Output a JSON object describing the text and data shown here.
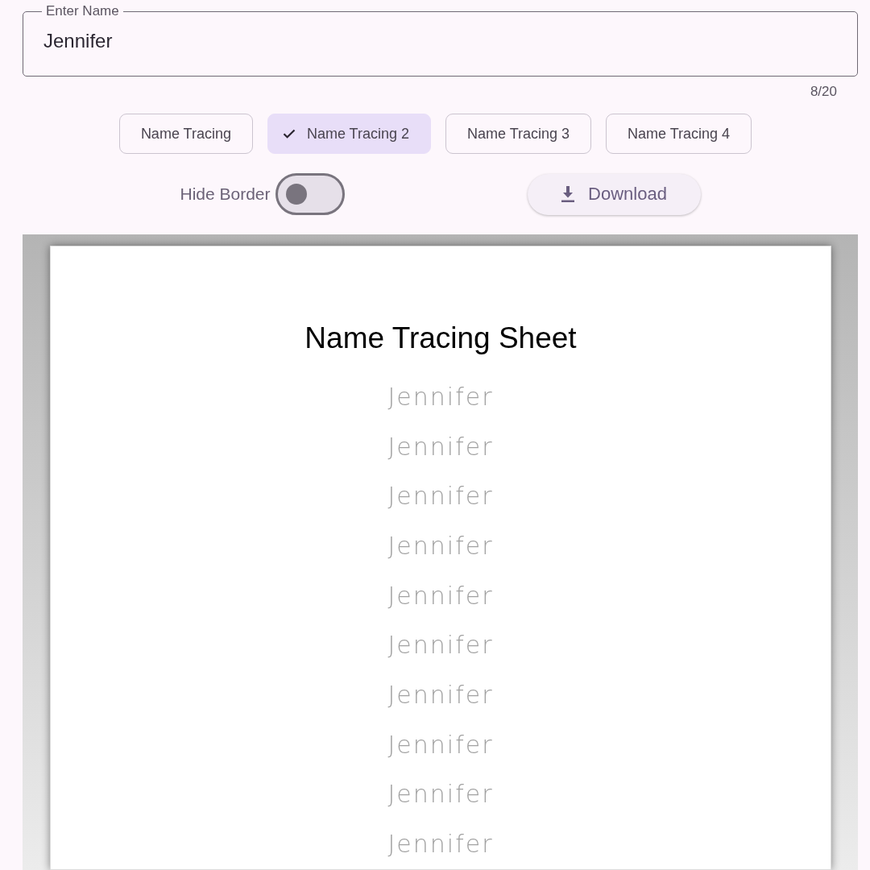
{
  "name_field": {
    "label": "Enter Name",
    "value": "Jennifer",
    "counter": "8/20"
  },
  "styles": [
    {
      "label": "Name Tracing",
      "selected": false
    },
    {
      "label": "Name Tracing 2",
      "selected": true
    },
    {
      "label": "Name Tracing 3",
      "selected": false
    },
    {
      "label": "Name Tracing 4",
      "selected": false
    }
  ],
  "hide_border": {
    "label": "Hide Border",
    "on": false
  },
  "download_button": {
    "label": "Download"
  },
  "sheet": {
    "title": "Name Tracing Sheet",
    "lines": [
      "Jennifer",
      "Jennifer",
      "Jennifer",
      "Jennifer",
      "Jennifer",
      "Jennifer",
      "Jennifer",
      "Jennifer",
      "Jennifer",
      "Jennifer"
    ]
  }
}
